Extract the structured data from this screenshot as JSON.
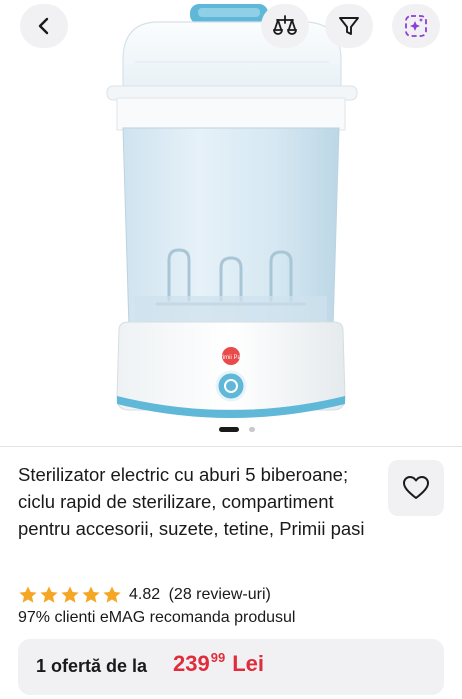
{
  "product": {
    "title": "Sterilizator electric cu aburi 5 biberoane; ciclu rapid de sterilizare, compartiment pentru accesorii, suzete, tetine, Primii pasi",
    "image_badge": "Primii Pasi",
    "rating": "4.82",
    "review_count": "(28 review-uri)",
    "stars_filled": 5,
    "recommend_text": "97% clienti eMAG recomanda produsul"
  },
  "offer": {
    "label": "1 ofertă de la",
    "price_int": "239",
    "price_dec": "99",
    "currency": "Lei"
  },
  "gallery": {
    "image_count": 2,
    "active_index": 0
  },
  "icons": {
    "back": "chevron-left-icon",
    "compare": "compare-scale-icon",
    "filter": "filter-funnel-icon",
    "ai": "ai-sparkle-icon",
    "favorite": "heart-icon",
    "star": "star-icon"
  },
  "colors": {
    "price": "#e02d3c",
    "star": "#f5a623",
    "ai_accent": "#8b3fd9",
    "button_bg": "#f1f1f3"
  }
}
